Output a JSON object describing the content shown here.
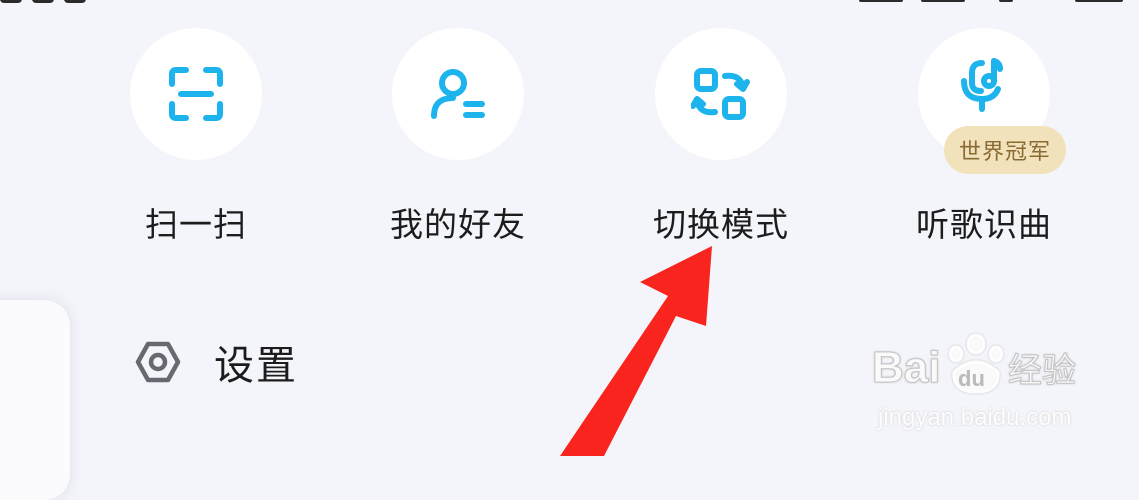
{
  "quick_actions": [
    {
      "label": "扫一扫",
      "icon": "scan-icon"
    },
    {
      "label": "我的好友",
      "icon": "friends-icon"
    },
    {
      "label": "切换模式",
      "icon": "switch-mode-icon"
    },
    {
      "label": "听歌识曲",
      "icon": "song-recognition-icon",
      "badge": "世界冠军"
    }
  ],
  "settings": {
    "label": "设置",
    "icon": "hexagon-settings-icon"
  },
  "annotation": {
    "type": "arrow",
    "color": "#f8241d",
    "points_to": "切换模式"
  },
  "watermark": {
    "url": "jingyan.baidu.com"
  },
  "colors": {
    "accent": "#1db3ec",
    "background": "#f4f5fa",
    "badge_bg": "#f1e2bb",
    "badge_text": "#8a6a33"
  }
}
